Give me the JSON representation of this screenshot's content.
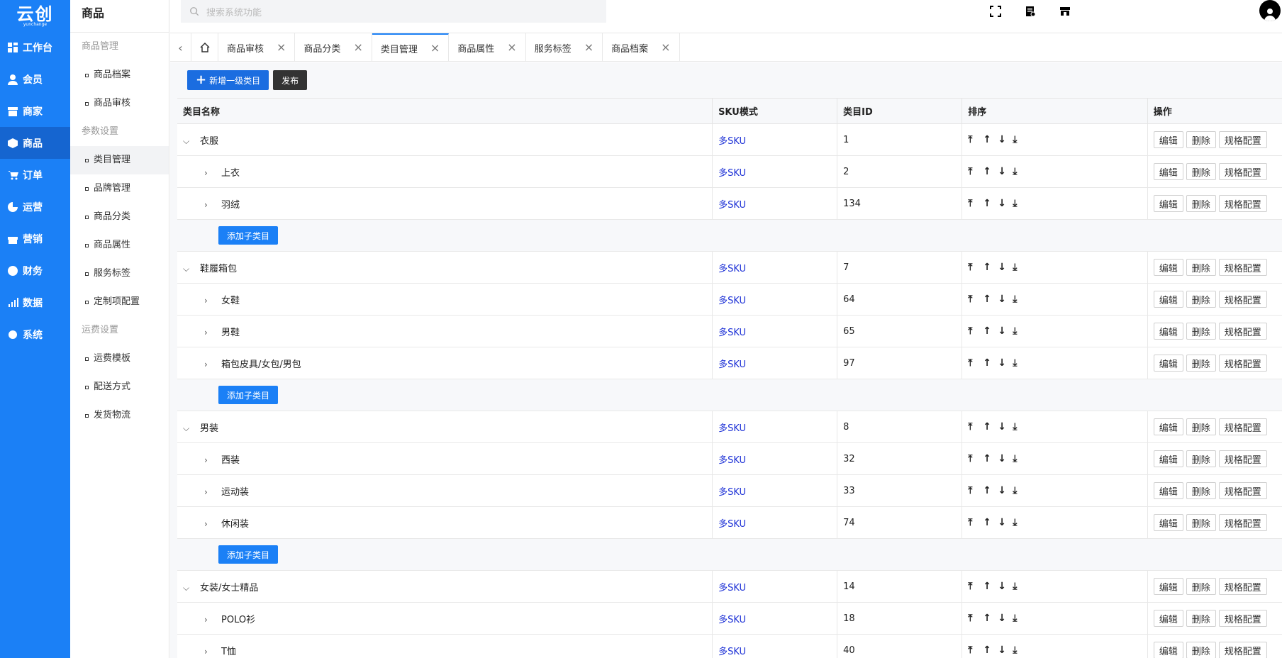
{
  "app": {
    "logo": "云创",
    "logo_sub": "yunchange"
  },
  "nav": {
    "items": [
      {
        "label": "工作台",
        "icon": "dashboard-icon"
      },
      {
        "label": "会员",
        "icon": "user-icon"
      },
      {
        "label": "商家",
        "icon": "store-icon"
      },
      {
        "label": "商品",
        "icon": "box-icon"
      },
      {
        "label": "订单",
        "icon": "cart-icon"
      },
      {
        "label": "运营",
        "icon": "pie-icon"
      },
      {
        "label": "营销",
        "icon": "gift-icon"
      },
      {
        "label": "财务",
        "icon": "yen-icon"
      },
      {
        "label": "数据",
        "icon": "chart-icon"
      },
      {
        "label": "系统",
        "icon": "gear-icon"
      }
    ],
    "active": "商品"
  },
  "sub": {
    "title": "商品",
    "groups": [
      {
        "label": "商品管理",
        "items": [
          "商品档案",
          "商品审核"
        ]
      },
      {
        "label": "参数设置",
        "items": [
          "类目管理",
          "品牌管理",
          "商品分类",
          "商品属性",
          "服务标签",
          "定制项配置"
        ]
      },
      {
        "label": "运费设置",
        "items": [
          "运费模板",
          "配送方式",
          "发货物流"
        ]
      }
    ],
    "active": "类目管理"
  },
  "header": {
    "search_placeholder": "搜索系统功能",
    "tools": [
      "fullscreen-icon",
      "document-icon",
      "shop-icon"
    ]
  },
  "tabs": [
    {
      "label": "商品审核"
    },
    {
      "label": "商品分类"
    },
    {
      "label": "类目管理",
      "active": true
    },
    {
      "label": "商品属性"
    },
    {
      "label": "服务标签"
    },
    {
      "label": "商品档案"
    }
  ],
  "toolbar": {
    "add_label": "新增一级类目",
    "publish_label": "发布"
  },
  "table": {
    "columns": [
      "类目名称",
      "SKU模式",
      "类目ID",
      "排序",
      "操作"
    ],
    "add_child_label": "添加子类目",
    "actions": [
      "编辑",
      "删除",
      "规格配置"
    ],
    "sort_arrows": [
      "⤒",
      "↑",
      "↓",
      "⤓"
    ],
    "groups": [
      {
        "name": "衣服",
        "sku": "多SKU",
        "id": "1",
        "children": [
          {
            "name": "上衣",
            "sku": "多SKU",
            "id": "2"
          },
          {
            "name": "羽绒",
            "sku": "多SKU",
            "id": "134"
          }
        ]
      },
      {
        "name": "鞋履箱包",
        "sku": "多SKU",
        "id": "7",
        "children": [
          {
            "name": "女鞋",
            "sku": "多SKU",
            "id": "64"
          },
          {
            "name": "男鞋",
            "sku": "多SKU",
            "id": "65"
          },
          {
            "name": "箱包皮具/女包/男包",
            "sku": "多SKU",
            "id": "97"
          }
        ]
      },
      {
        "name": "男装",
        "sku": "多SKU",
        "id": "8",
        "children": [
          {
            "name": "西装",
            "sku": "多SKU",
            "id": "32"
          },
          {
            "name": "运动装",
            "sku": "多SKU",
            "id": "33"
          },
          {
            "name": "休闲装",
            "sku": "多SKU",
            "id": "74"
          }
        ]
      },
      {
        "name": "女装/女士精品",
        "sku": "多SKU",
        "id": "14",
        "children": [
          {
            "name": "POLO衫",
            "sku": "多SKU",
            "id": "18"
          },
          {
            "name": "T恤",
            "sku": "多SKU",
            "id": "40"
          }
        ]
      }
    ]
  }
}
